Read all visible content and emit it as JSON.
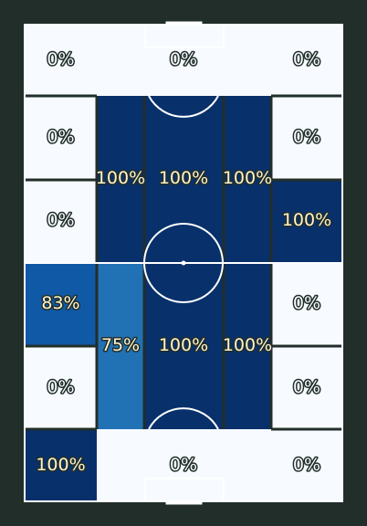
{
  "colors": {
    "background": "#222e2a",
    "pitch_lines": "#ffffff",
    "zone_divider": "#222e2a"
  },
  "pitch": {
    "orientation": "vertical",
    "zones": [
      {
        "id": "z1",
        "label": "0%",
        "value": 0,
        "fill": "#f7fbff",
        "text_color": "#f7fbff",
        "outline": "#222e2a"
      },
      {
        "id": "z2",
        "label": "0%",
        "value": 0,
        "fill": "#f7fbff",
        "text_color": "#f7fbff",
        "outline": "#222e2a"
      },
      {
        "id": "z3",
        "label": "0%",
        "value": 0,
        "fill": "#f7fbff",
        "text_color": "#f7fbff",
        "outline": "#222e2a"
      },
      {
        "id": "z4",
        "label": "0%",
        "value": 0,
        "fill": "#f7fbff",
        "text_color": "#f7fbff",
        "outline": "#222e2a"
      },
      {
        "id": "z5",
        "label": "100%",
        "value": 100,
        "fill": "#08306b",
        "text_color": "#fff4cc",
        "outline": "#222e2a"
      },
      {
        "id": "z6",
        "label": "100%",
        "value": 100,
        "fill": "#08306b",
        "text_color": "#fff4cc",
        "outline": "#222e2a"
      },
      {
        "id": "z7",
        "label": "100%",
        "value": 100,
        "fill": "#08306b",
        "text_color": "#fff4cc",
        "outline": "#222e2a"
      },
      {
        "id": "z8",
        "label": "0%",
        "value": 0,
        "fill": "#f7fbff",
        "text_color": "#f7fbff",
        "outline": "#222e2a"
      },
      {
        "id": "z9",
        "label": "0%",
        "value": 0,
        "fill": "#f7fbff",
        "text_color": "#f7fbff",
        "outline": "#222e2a"
      },
      {
        "id": "z10",
        "label": "100%",
        "value": 100,
        "fill": "#08306b",
        "text_color": "#fff4cc",
        "outline": "#222e2a"
      },
      {
        "id": "z11",
        "label": "83%",
        "value": 83,
        "fill": "#1059a6",
        "text_color": "#fff4cc",
        "outline": "#222e2a"
      },
      {
        "id": "z12",
        "label": "75%",
        "value": 75,
        "fill": "#2171b5",
        "text_color": "#fff4cc",
        "outline": "#222e2a"
      },
      {
        "id": "z13",
        "label": "100%",
        "value": 100,
        "fill": "#08306b",
        "text_color": "#fff4cc",
        "outline": "#222e2a"
      },
      {
        "id": "z14",
        "label": "100%",
        "value": 100,
        "fill": "#08306b",
        "text_color": "#fff4cc",
        "outline": "#222e2a"
      },
      {
        "id": "z15",
        "label": "0%",
        "value": 0,
        "fill": "#f7fbff",
        "text_color": "#f7fbff",
        "outline": "#222e2a"
      },
      {
        "id": "z16",
        "label": "0%",
        "value": 0,
        "fill": "#f7fbff",
        "text_color": "#f7fbff",
        "outline": "#222e2a"
      },
      {
        "id": "z17",
        "label": "0%",
        "value": 0,
        "fill": "#f7fbff",
        "text_color": "#f7fbff",
        "outline": "#222e2a"
      },
      {
        "id": "z18",
        "label": "0%",
        "value": 0,
        "fill": "#f7fbff",
        "text_color": "#f7fbff",
        "outline": "#222e2a"
      },
      {
        "id": "z19",
        "label": "100%",
        "value": 100,
        "fill": "#08306b",
        "text_color": "#fff4cc",
        "outline": "#222e2a"
      },
      {
        "id": "z20",
        "label": "0%",
        "value": 0,
        "fill": "#f7fbff",
        "text_color": "#f7fbff",
        "outline": "#222e2a"
      },
      {
        "id": "z21",
        "label": "0%",
        "value": 0,
        "fill": "#f7fbff",
        "text_color": "#f7fbff",
        "outline": "#222e2a"
      }
    ]
  }
}
